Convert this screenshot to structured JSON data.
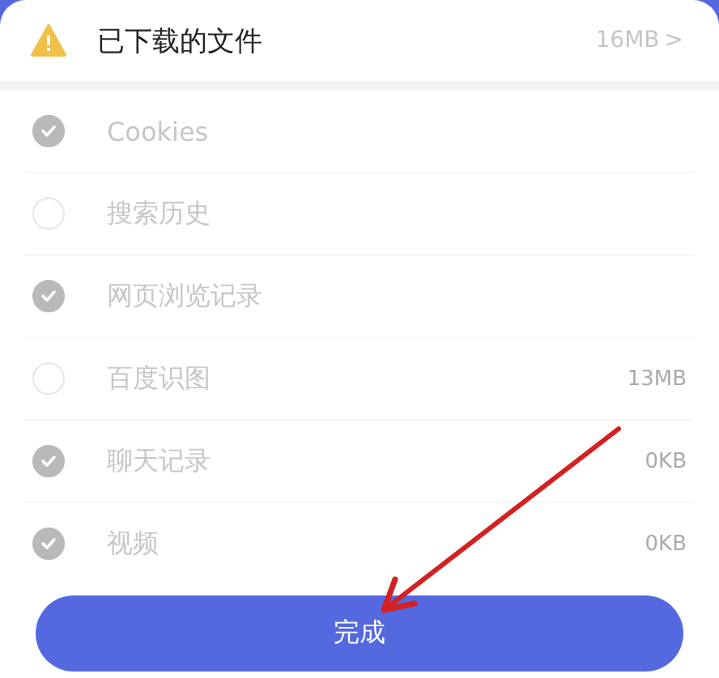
{
  "header": {
    "title": "已下载的文件",
    "size": "16MB",
    "chevron": ">"
  },
  "items": [
    {
      "label": "Cookies",
      "checked": true
    },
    {
      "label": "搜索历史",
      "checked": false
    },
    {
      "label": "网页浏览记录",
      "checked": true
    },
    {
      "label": "百度识图",
      "checked": false,
      "size": "13MB"
    },
    {
      "label": "聊天记录",
      "checked": true,
      "size": "0KB"
    },
    {
      "label": "视频",
      "checked": true,
      "size": "0KB"
    }
  ],
  "done_button": "完成"
}
